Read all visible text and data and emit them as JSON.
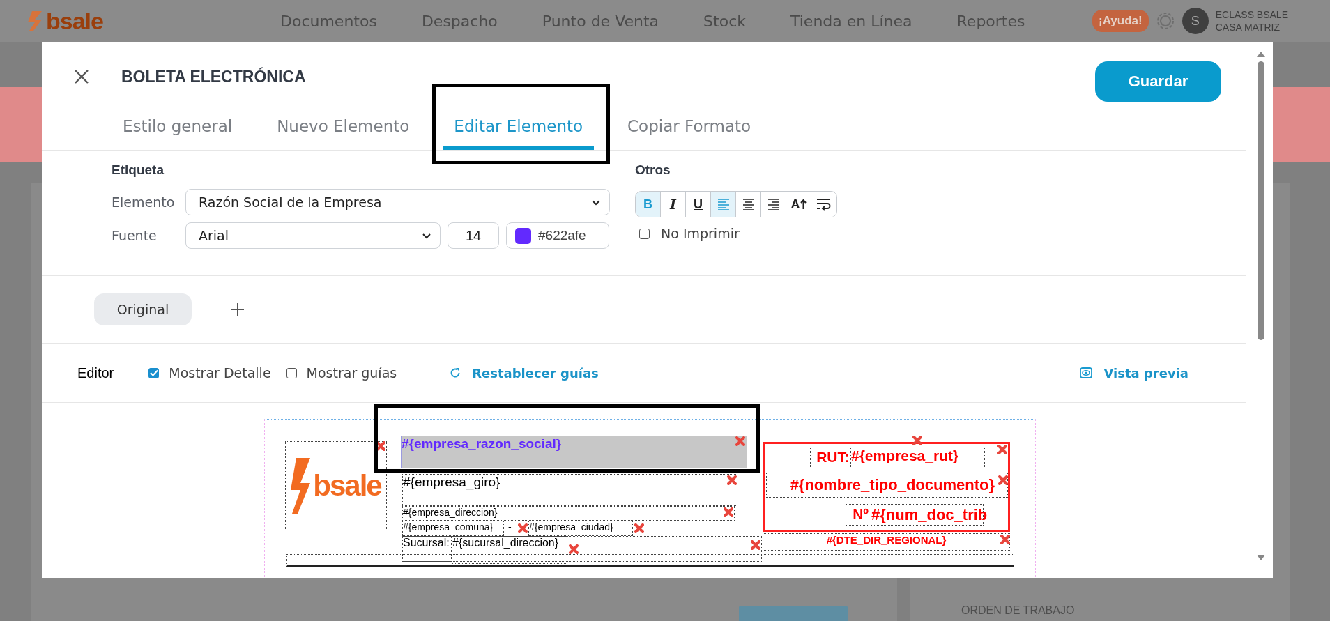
{
  "app_header": {
    "logo": "bsale",
    "nav": [
      "Documentos",
      "Despacho",
      "Punto de Venta",
      "Stock",
      "Tienda en Línea",
      "Reportes"
    ],
    "help": "¡Ayuda!",
    "avatar": "S",
    "account": [
      "ECLASS BSALE",
      "CASA MATRIZ"
    ]
  },
  "background": {
    "side_items": [
      "ORDEN DE TRABAJO"
    ]
  },
  "modal": {
    "title": "BOLETA ELECTRÓNICA",
    "save": "Guardar",
    "tabs": [
      {
        "label": "Estilo general",
        "selected": false
      },
      {
        "label": "Nuevo Elemento",
        "selected": false
      },
      {
        "label": "Editar Elemento",
        "selected": true
      },
      {
        "label": "Copiar Formato",
        "selected": false
      }
    ],
    "etiqueta": {
      "heading": "Etiqueta",
      "element_label": "Elemento",
      "element_value": "Razón Social de la Empresa",
      "font_label": "Fuente",
      "font_value": "Arial",
      "size": "14",
      "color": "#622afe",
      "color_text": "#622afe"
    },
    "otros": {
      "heading": "Otros",
      "format_buttons": [
        {
          "kind": "bold",
          "label": "B",
          "selected": true
        },
        {
          "kind": "italic",
          "label": "I",
          "selected": false
        },
        {
          "kind": "underline",
          "label": "U",
          "selected": false
        },
        {
          "kind": "align-left",
          "selected": true
        },
        {
          "kind": "align-center",
          "selected": false
        },
        {
          "kind": "align-right",
          "selected": false
        },
        {
          "kind": "font-grow",
          "label": "A",
          "selected": false
        },
        {
          "kind": "wrap",
          "selected": false
        }
      ],
      "no_print": {
        "label": "No Imprimir",
        "checked": false
      }
    },
    "versions": [
      {
        "label": "Original",
        "selected": true
      }
    ],
    "editor": {
      "label": "Editor",
      "show_detail": {
        "label": "Mostrar Detalle",
        "checked": true
      },
      "show_guides": {
        "label": "Mostrar guías",
        "checked": false
      },
      "reset": "Restablecer guías",
      "preview": "Vista previa"
    },
    "canvas": {
      "elements": [
        {
          "kind": "logo",
          "text": "bsale",
          "selected": false
        },
        {
          "kind": "field",
          "text": "#{empresa_razon_social}",
          "selected": true,
          "color": "#622afe"
        },
        {
          "kind": "field",
          "text": "#{empresa_giro}",
          "selected": false,
          "color": "#000000"
        },
        {
          "kind": "field",
          "text": "#{empresa_direccion}",
          "selected": false,
          "color": "#000000"
        },
        {
          "kind": "field",
          "text": "#{empresa_comuna}",
          "selected": false,
          "color": "#000000"
        },
        {
          "kind": "text",
          "text": "-",
          "selected": false,
          "color": "#000000"
        },
        {
          "kind": "field",
          "text": "#{empresa_ciudad}",
          "selected": false,
          "color": "#000000"
        },
        {
          "kind": "field",
          "text": "Sucursal:",
          "selected": false,
          "color": "#000000"
        },
        {
          "kind": "field",
          "text": "#{sucursal_direccion}",
          "selected": false,
          "color": "#000000"
        },
        {
          "kind": "field",
          "text": "RUT:",
          "selected": false,
          "color": "#ff0000"
        },
        {
          "kind": "field",
          "text": "#{empresa_rut}",
          "selected": false,
          "color": "#ff0000"
        },
        {
          "kind": "field",
          "text": "#{nombre_tipo_documento}",
          "selected": false,
          "color": "#ff0000"
        },
        {
          "kind": "field",
          "text": "Nº",
          "selected": false,
          "color": "#ff0000"
        },
        {
          "kind": "field",
          "text": "#{num_doc_trib",
          "selected": false,
          "color": "#ff0000"
        },
        {
          "kind": "field",
          "text": "#{DTE_DIR_REGIONAL}",
          "selected": false,
          "color": "#ff0000"
        }
      ]
    }
  }
}
